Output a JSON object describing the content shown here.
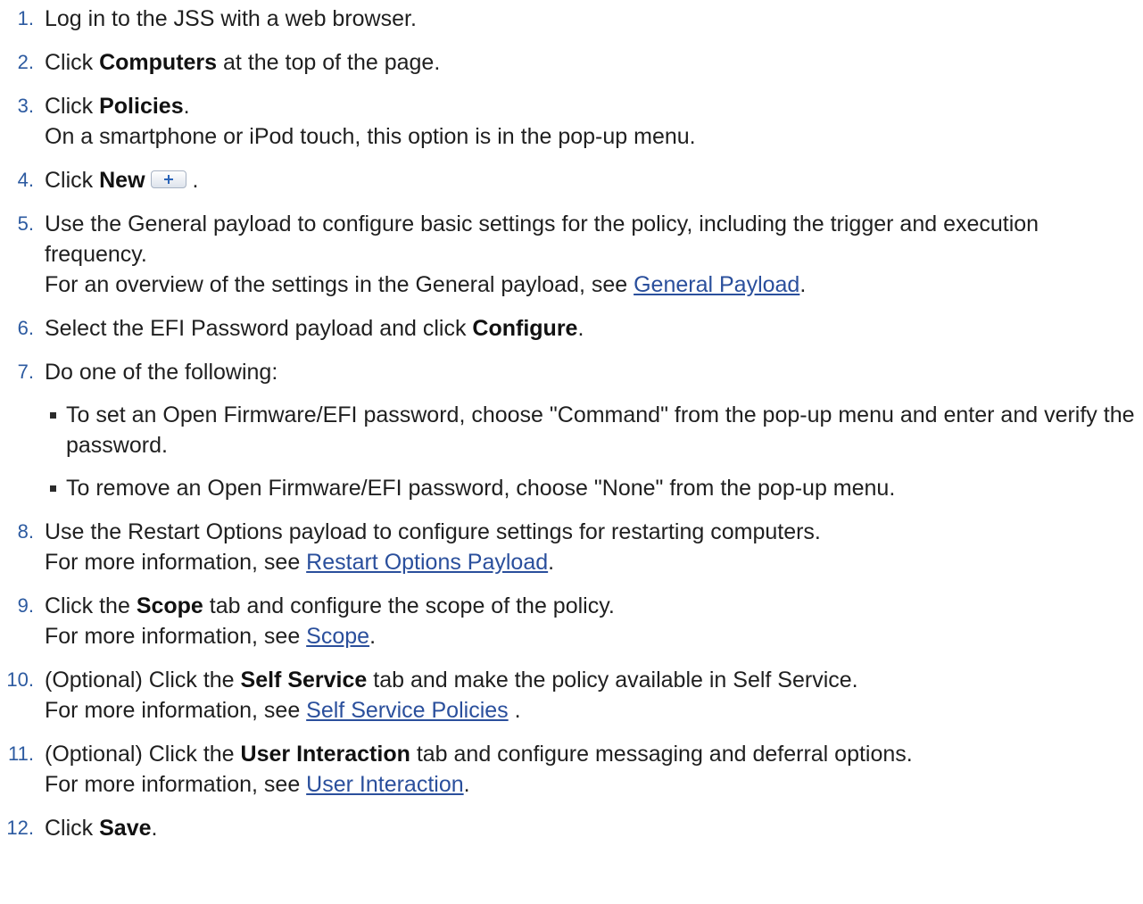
{
  "steps": [
    {
      "n": "1.",
      "t1": "Log in to the JSS with a web browser."
    },
    {
      "n": "2.",
      "t1": "Click ",
      "b1": "Computers",
      "t2": " at the top of the page."
    },
    {
      "n": "3.",
      "t1": "Click ",
      "b1": "Policies",
      "t2": ".",
      "note": "On a smartphone or iPod touch, this option is in the pop-up menu."
    },
    {
      "n": "4.",
      "t1": "Click ",
      "b1": "New",
      "t2": " ."
    },
    {
      "n": "5.",
      "t1": "Use the General payload to configure basic settings for the policy, including the trigger and execution frequency.",
      "note": "For an overview of the settings in the General payload, see ",
      "link": "General Payload",
      "after": "."
    },
    {
      "n": "6.",
      "t1": "Select the EFI Password payload and click ",
      "b1": "Configure",
      "t2": "."
    },
    {
      "n": "7.",
      "t1": "Do one of the following:",
      "bullets": [
        "To set an Open Firmware/EFI password, choose \"Command\" from the pop-up menu and enter and verify the password.",
        "To remove an Open Firmware/EFI password, choose \"None\" from the pop-up menu."
      ]
    },
    {
      "n": "8.",
      "t1": "Use the Restart Options payload to configure settings for restarting computers.",
      "note": "For more information, see ",
      "link": "Restart Options Payload",
      "after": "."
    },
    {
      "n": "9.",
      "t1": "Click the ",
      "b1": "Scope",
      "t2": " tab and configure the scope of the policy.",
      "note": "For more information, see ",
      "link": "Scope",
      "after": "."
    },
    {
      "n": "10.",
      "t1": "(Optional) Click the ",
      "b1": "Self Service",
      "t2": " tab and make the policy available in Self Service.",
      "note": "For more information, see ",
      "link": "Self Service Policies",
      "after": " ."
    },
    {
      "n": "11.",
      "t1": "(Optional) Click the ",
      "b1": "User Interaction",
      "t2": " tab and configure messaging and deferral options.",
      "note": "For more information, see ",
      "link": "User Interaction",
      "after": "."
    },
    {
      "n": "12.",
      "t1": "Click ",
      "b1": "Save",
      "t2": "."
    }
  ],
  "icons": {
    "new_button": "plus-icon"
  }
}
